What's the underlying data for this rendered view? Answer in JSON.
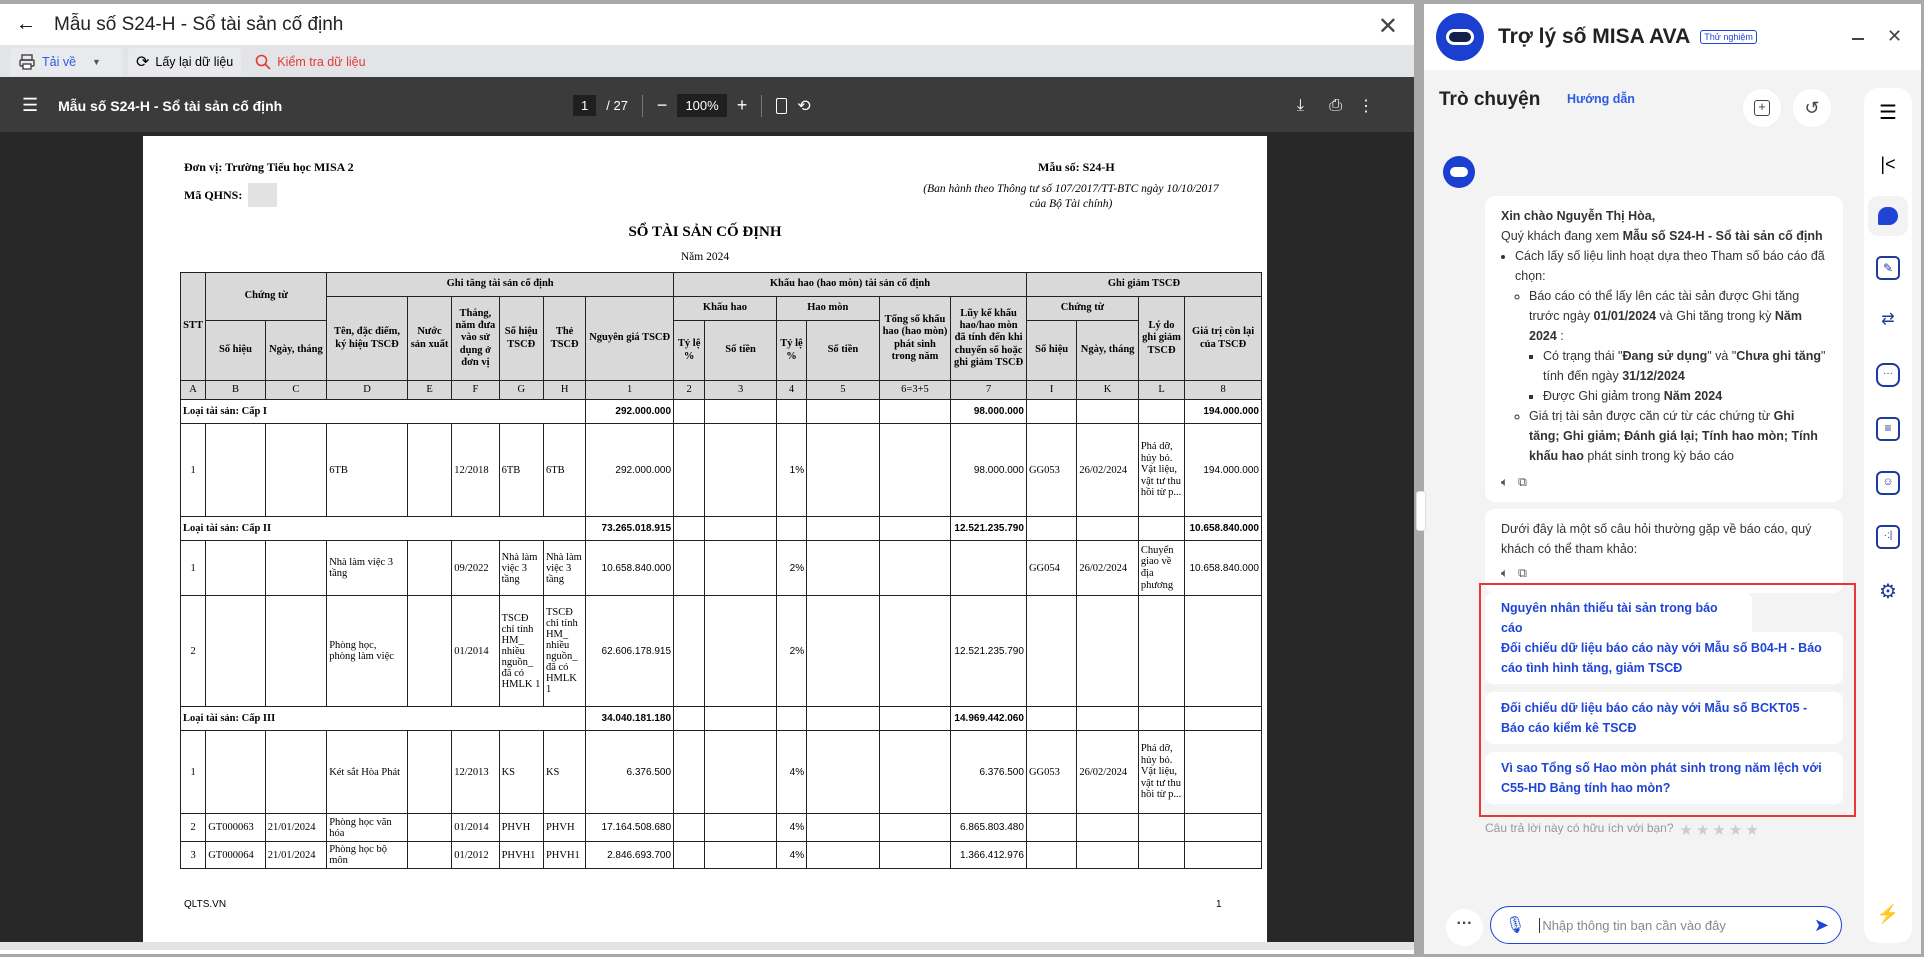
{
  "window": {
    "title": "Mẫu số S24-H - Sổ tài sản cố định"
  },
  "toolbar": {
    "download": "Tải về",
    "reload": "Lấy lại dữ liệu",
    "check": "Kiểm tra dữ liệu"
  },
  "pdf": {
    "title": "Mẫu số S24-H - Sổ tài sản cố định",
    "page": "1",
    "total": "/ 27",
    "zoom": "100%"
  },
  "report": {
    "unit": "Đơn vị: Trường Tiểu học MISA 2",
    "qhns": "Mã QHNS:",
    "form": "Mẫu số: S24-H",
    "issued1": "(Ban hành theo Thông tư số 107/2017/TT-BTC ngày 10/10/2017",
    "issued2": "của Bộ Tài chính)",
    "title": "SỔ TÀI SẢN CỐ ĐỊNH",
    "year": "Năm 2024",
    "footer_left": "QLTS.VN",
    "footer_page": "1",
    "h": {
      "stt": "STT",
      "ct": "Chứng từ",
      "ghitang": "Ghi tăng tài sản cố định",
      "kh": "Khấu hao (hao mòn) tài sản cố định",
      "ghigiam": "Ghi giảm TSCĐ",
      "sohieu": "Số hiệu",
      "ngay": "Ngày, tháng",
      "ten": "Tên, đặc điểm, ký hiệu TSCĐ",
      "nuoc": "Nước sản xuất",
      "thang": "Tháng, năm đưa vào sử dụng ở đơn vị",
      "sohieutscd": "Số hiệu TSCĐ",
      "the": "Thẻ TSCĐ",
      "nguyengia": "Nguyên giá TSCĐ",
      "khauhao": "Khấu hao",
      "haomon": "Hao mòn",
      "tyle": "Tỷ lệ %",
      "sotien": "Số tiền",
      "tong": "Tổng số khấu hao (hao mòn) phát sinh trong năm",
      "luyke": "Lũy kế khấu hao/hao mòn đã tính đến khi chuyển số hoặc ghi giảm TSCĐ",
      "lydo": "Lý do ghi giảm TSCĐ",
      "gtcl": "Giá trị còn lại của TSCĐ"
    },
    "letters": [
      "A",
      "B",
      "C",
      "D",
      "E",
      "F",
      "G",
      "H",
      "1",
      "2",
      "3",
      "4",
      "5",
      "6=3+5",
      "7",
      "I",
      "K",
      "L",
      "8"
    ],
    "rows": [
      {
        "group": "Loại tài sản: Cấp I",
        "ng": "292.000.000",
        "lk": "98.000.000",
        "gt": "194.000.000"
      },
      {
        "c": [
          "1",
          "",
          "",
          "6TB",
          "",
          "12/2018",
          "6TB",
          "6TB",
          "292.000.000",
          "",
          "",
          "1%",
          "",
          "",
          "98.000.000",
          "GG053",
          "26/02/2024",
          "Phá dỡ, hủy bỏ. Vật liệu, vật tư thu hồi từ p...",
          "194.000.000"
        ],
        "h": 93
      },
      {
        "group": "Loại tài sản: Cấp II",
        "ng": "73.265.018.915",
        "lk": "12.521.235.790",
        "gt": "10.658.840.000"
      },
      {
        "c": [
          "1",
          "",
          "",
          "Nhà làm việc 3 tầng",
          "",
          "09/2022",
          "Nhà làm việc 3 tầng",
          "Nhà làm việc 3 tầng",
          "10.658.840.000",
          "",
          "",
          "2%",
          "",
          "",
          "",
          "GG054",
          "26/02/2024",
          "Chuyển giao về địa phương",
          "10.658.840.000"
        ],
        "h": 55
      },
      {
        "c": [
          "2",
          "",
          "",
          "Phòng học, phòng làm việc",
          "",
          "01/2014",
          "TSCĐ chỉ tính HM_ nhiều nguồn_ đã có HMLK 1",
          "TSCĐ chỉ tính HM_ nhiều nguồn_ đã có HMLK 1",
          "62.606.178.915",
          "",
          "",
          "2%",
          "",
          "",
          "12.521.235.790",
          "",
          "",
          "",
          ""
        ],
        "h": 111,
        "dot": true
      },
      {
        "group": "Loại tài sản: Cấp III",
        "ng": "34.040.181.180",
        "lk": "14.969.442.060",
        "gt": ""
      },
      {
        "c": [
          "1",
          "",
          "",
          "Két sắt Hòa Phát",
          "",
          "12/2013",
          "KS",
          "KS",
          "6.376.500",
          "",
          "",
          "4%",
          "",
          "",
          "6.376.500",
          "GG053",
          "26/02/2024",
          "Phá dỡ, hủy bỏ. Vật liệu, vật tư thu hồi từ p...",
          ""
        ],
        "h": 83
      },
      {
        "c": [
          "2",
          "GT000063",
          "21/01/2024",
          "Phòng học văn hóa",
          "",
          "01/2014",
          "PHVH",
          "PHVH",
          "17.164.508.680",
          "",
          "",
          "4%",
          "",
          "",
          "6.865.803.480",
          "",
          "",
          "",
          ""
        ],
        "h": 28,
        "dot": true
      },
      {
        "c": [
          "3",
          "GT000064",
          "21/01/2024",
          "Phòng học bộ môn",
          "",
          "01/2012",
          "PHVH1",
          "PHVH1",
          "2.846.693.700",
          "",
          "",
          "4%",
          "",
          "",
          "1.366.412.976",
          "",
          "",
          "",
          ""
        ],
        "h": 27,
        "dot": true
      }
    ]
  },
  "assistant": {
    "title": "Trợ lý số MISA AVA",
    "badge": "Thử nghiệm",
    "tab": "Trò chuyện",
    "guide": "Hướng dẫn",
    "greet": "Xin chào Nguyễn Thị Hòa,",
    "view_pre": "Quý khách đang xem ",
    "view_bold": "Mẫu số S24-H - Sổ tài sản cố định",
    "b1": "Cách lấy số liệu linh hoạt dựa theo Tham số báo cáo đã chọn:",
    "b2a": "Báo cáo có thể lấy lên các tài sản được Ghi tăng trước ngày ",
    "b2b": "01/01/2024",
    "b2c": " và Ghi tăng trong kỳ ",
    "b2d": "Năm 2024",
    "b2e": " :",
    "b3a": "Có trạng thái \"",
    "b3b": "Đang sử dụng",
    "b3c": "\" và \"",
    "b3d": "Chưa ghi tăng",
    "b3e": "\" tính đến ngày ",
    "b3f": "31/12/2024",
    "b4a": "Được Ghi giảm trong ",
    "b4b": "Năm 2024",
    "b5a": "Giá trị tài sản được căn cứ từ các chứng từ ",
    "b5b": "Ghi tăng; Ghi giảm; Đánh giá lại; Tính hao mòn; Tính khấu hao",
    "b5c": " phát sinh trong kỳ báo cáo",
    "faq_intro": "Dưới đây là một số câu hỏi thường gặp về báo cáo, quý khách có thể tham khảo:",
    "suggestions": [
      "Nguyên nhân thiếu tài sản trong báo cáo",
      "Đối chiếu dữ liệu báo cáo này với Mẫu số B04-H - Báo cáo tình hình tăng, giảm TSCĐ",
      "Đối chiếu dữ liệu báo cáo này với Mẫu số BCKT05 - Báo cáo kiểm kê TSCĐ",
      "Vì sao Tổng số Hao mòn phát sinh trong năm lệch với C55-HD Bảng tính hao mòn?"
    ],
    "rating": "Câu trả lời này có hữu ích với bạn?",
    "rating_value": 0,
    "input_placeholder": "Nhập thông tin bạn cần vào đây"
  },
  "colors": {
    "accent": "#1f44d6",
    "danger": "#e53935"
  }
}
